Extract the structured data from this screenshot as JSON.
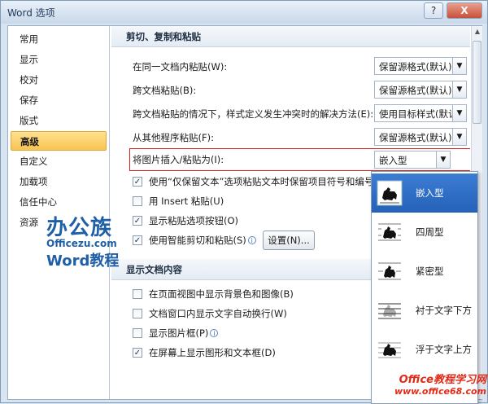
{
  "window": {
    "title": "Word 选项",
    "help_label": "?",
    "close_label": "X"
  },
  "nav": {
    "items": [
      {
        "label": "常用"
      },
      {
        "label": "显示"
      },
      {
        "label": "校对"
      },
      {
        "label": "保存"
      },
      {
        "label": "版式"
      },
      {
        "label": "高级",
        "selected": true
      },
      {
        "label": "自定义"
      },
      {
        "label": "加载项"
      },
      {
        "label": "信任中心"
      },
      {
        "label": "资源"
      }
    ]
  },
  "section_paste": {
    "title": "剪切、复制和粘贴"
  },
  "paste_options": [
    {
      "label": "在同一文档内粘贴(W):",
      "value": "保留源格式(默认)"
    },
    {
      "label": "跨文档粘贴(B):",
      "value": "保留源格式(默认)"
    },
    {
      "label": "跨文档粘贴的情况下，样式定义发生冲突时的解决方法(E):",
      "value": "使用目标样式(默认)"
    },
    {
      "label": "从其他程序粘贴(F):",
      "value": "保留源格式(默认)"
    },
    {
      "label": "将图片插入/粘贴为(I):",
      "value": "嵌入型"
    }
  ],
  "checkboxes": [
    {
      "label": "使用“仅保留文本”选项粘贴文本时保留项目符号和编号",
      "checked": true
    },
    {
      "label": "用 Insert 粘贴(U)",
      "checked": false
    },
    {
      "label": "显示粘贴选项按钮(O)",
      "checked": true
    },
    {
      "label": "使用智能剪切和粘贴(S)",
      "checked": true
    }
  ],
  "settings_button": "设置(N)...",
  "section_display": {
    "title": "显示文档内容"
  },
  "display_checkboxes": [
    {
      "label": "在页面视图中显示背景色和图像(B)",
      "checked": false
    },
    {
      "label": "文档窗口内显示文字自动换行(W)",
      "checked": false
    },
    {
      "label": "显示图片框(P)",
      "checked": false
    },
    {
      "label": "在屏幕上显示图形和文本框(D)",
      "checked": true
    }
  ],
  "wrap_dropdown": {
    "items": [
      {
        "label": "嵌入型",
        "icon": "inline-wrap-icon",
        "selected": true
      },
      {
        "label": "四周型",
        "icon": "square-wrap-icon"
      },
      {
        "label": "紧密型",
        "icon": "tight-wrap-icon"
      },
      {
        "label": "衬于文字下方",
        "icon": "behind-text-icon"
      },
      {
        "label": "浮于文字上方",
        "icon": "in-front-text-icon"
      }
    ]
  },
  "watermark_logo": {
    "big": "办公族",
    "site": "Officezu.com",
    "tutorial": "Word教程"
  },
  "watermark_site": {
    "line1": "Office教程学习网",
    "line2": "www.office68.com"
  },
  "colors": {
    "accent": "#f8c452",
    "highlight_border": "#d21f1f",
    "selected_blue": "#2e6fc6"
  }
}
